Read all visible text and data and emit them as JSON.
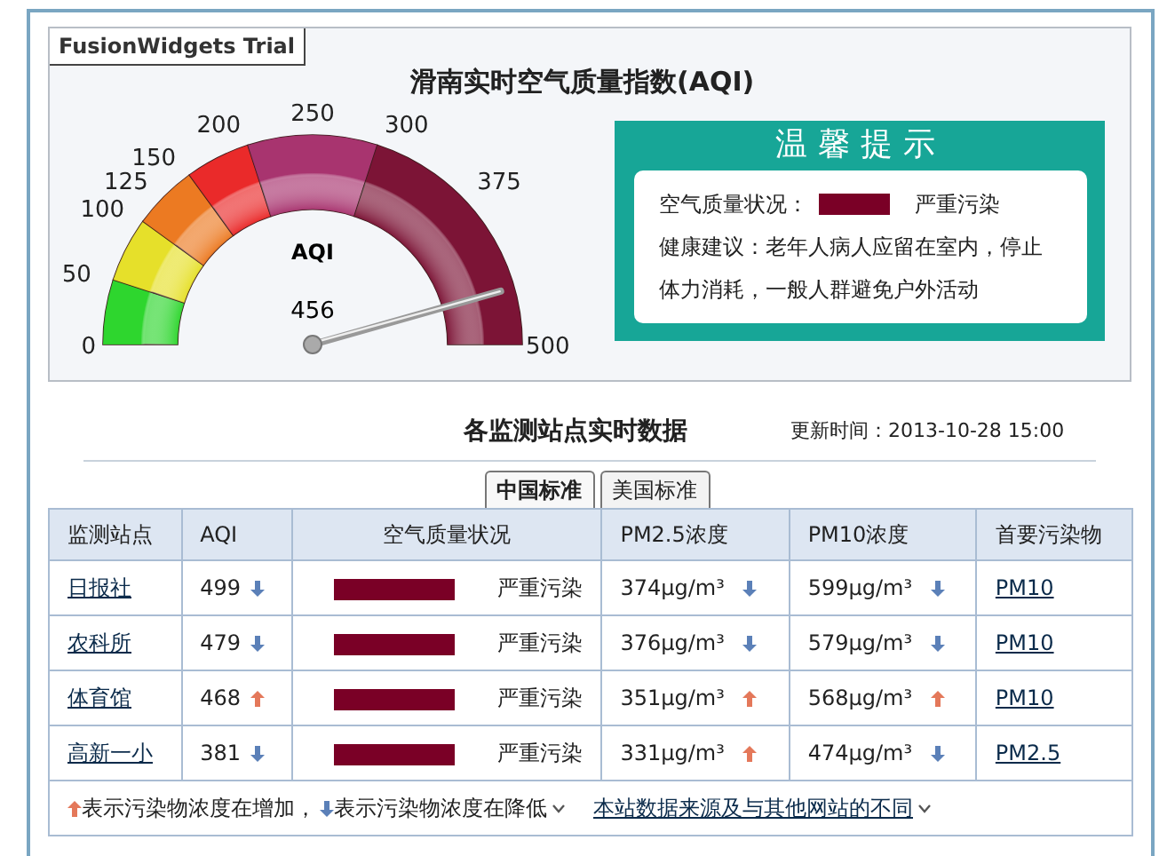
{
  "badge": "FusionWidgets Trial",
  "title": "滑南实时空气质量指数(AQI)",
  "gauge": {
    "label": "AQI",
    "value_label": "456",
    "ticks": [
      "250",
      "200",
      "300",
      "150",
      "125",
      "375",
      "100",
      "50",
      "0",
      "500"
    ],
    "bands": [
      {
        "color": "#2ed62e"
      },
      {
        "color": "#e6e02a"
      },
      {
        "color": "#ec7a22"
      },
      {
        "color": "#ea2a2a"
      },
      {
        "color": "#a8346f"
      },
      {
        "color": "#7c1436"
      }
    ]
  },
  "tip": {
    "heading": "温馨提示",
    "status_label": "空气质量状况：",
    "color": "#7a0026",
    "status": "严重污染",
    "advice": "健康建议：老年人病人应留在室内，停止体力消耗，一般人群避免户外活动"
  },
  "section_title": "各监测站点实时数据",
  "updated": "更新时间：2013-10-28 15:00",
  "tabs": [
    {
      "label": "中国标准",
      "selected": true
    },
    {
      "label": "美国标准",
      "selected": false
    }
  ],
  "columns": [
    "监测站点",
    "AQI",
    "空气质量状况",
    "PM2.5浓度",
    "PM10浓度",
    "首要污染物"
  ],
  "rows": [
    {
      "station": "日报社",
      "aqi": "499",
      "aqi_rising": false,
      "color": "#7a0026",
      "quality": "严重污染",
      "pm25": "374μg/m³",
      "pm25_rising": false,
      "pm10": "599μg/m³",
      "pm10_rising": false,
      "primary": "PM10"
    },
    {
      "station": "农科所",
      "aqi": "479",
      "aqi_rising": false,
      "color": "#7a0026",
      "quality": "严重污染",
      "pm25": "376μg/m³",
      "pm25_rising": false,
      "pm10": "579μg/m³",
      "pm10_rising": false,
      "primary": "PM10"
    },
    {
      "station": "体育馆",
      "aqi": "468",
      "aqi_rising": true,
      "color": "#7a0026",
      "quality": "严重污染",
      "pm25": "351μg/m³",
      "pm25_rising": true,
      "pm10": "568μg/m³",
      "pm10_rising": true,
      "primary": "PM10"
    },
    {
      "station": "高新一小",
      "aqi": "381",
      "aqi_rising": false,
      "color": "#7a0026",
      "quality": "严重污染",
      "pm25": "331μg/m³",
      "pm25_rising": true,
      "pm10": "474μg/m³",
      "pm10_rising": false,
      "primary": "PM2.5"
    }
  ],
  "legend": {
    "up_text": "表示污染物浓度在增加，",
    "down_text": "表示污染物浓度在降低",
    "link": "本站数据来源及与其他网站的不同"
  }
}
